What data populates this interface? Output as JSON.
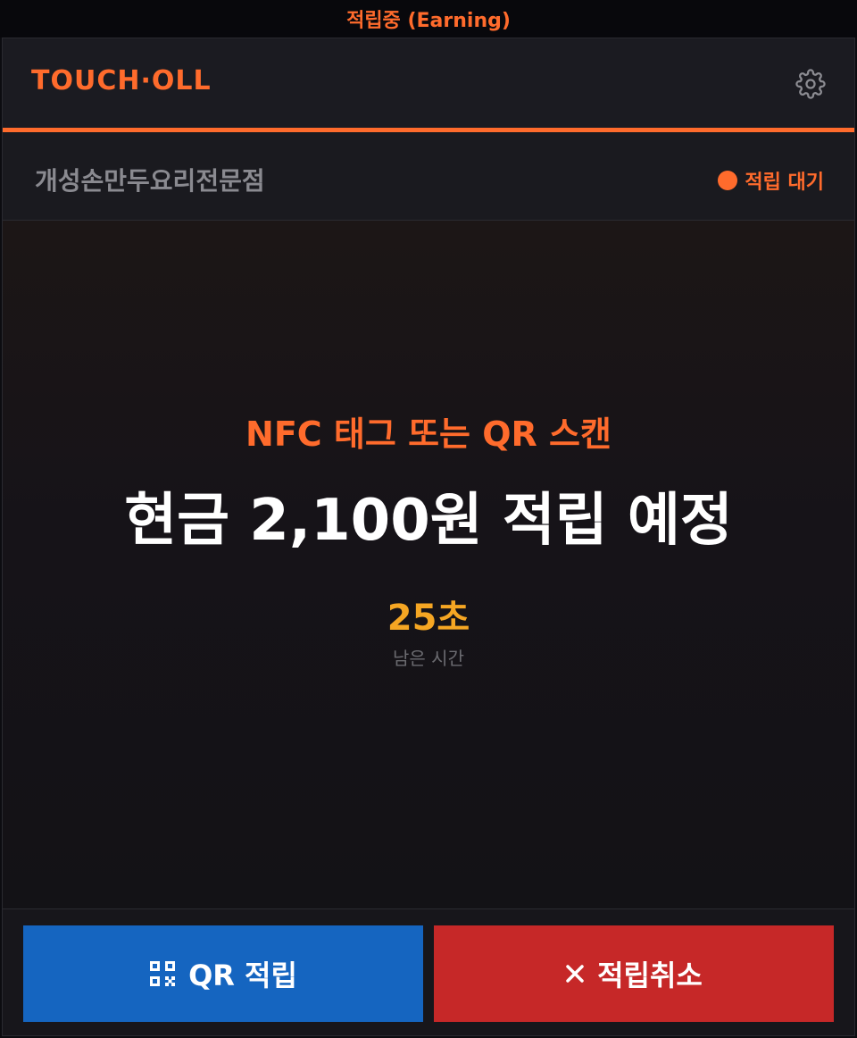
{
  "window": {
    "title": "적립중 (Earning)"
  },
  "header": {
    "brand": "TOUCH·OLL",
    "settings_icon": "gear-icon"
  },
  "store": {
    "name": "개성손만두요리전문점",
    "status_label": "적립 대기",
    "status_color": "#ff6b2c"
  },
  "main": {
    "prompt": "NFC 태그 또는 QR 스캔",
    "amount_text": "현금 2,100원 적립 예정",
    "countdown": "25초",
    "countdown_label": "남은 시간"
  },
  "footer": {
    "qr_button": {
      "icon": "qr-code-icon",
      "label": "QR 적립",
      "color": "#1565c0"
    },
    "cancel_button": {
      "icon": "close-icon",
      "label": "적립취소",
      "color": "#c62828"
    }
  },
  "colors": {
    "accent": "#ff6b2c",
    "countdown": "#f5a623",
    "background": "#17161b"
  }
}
